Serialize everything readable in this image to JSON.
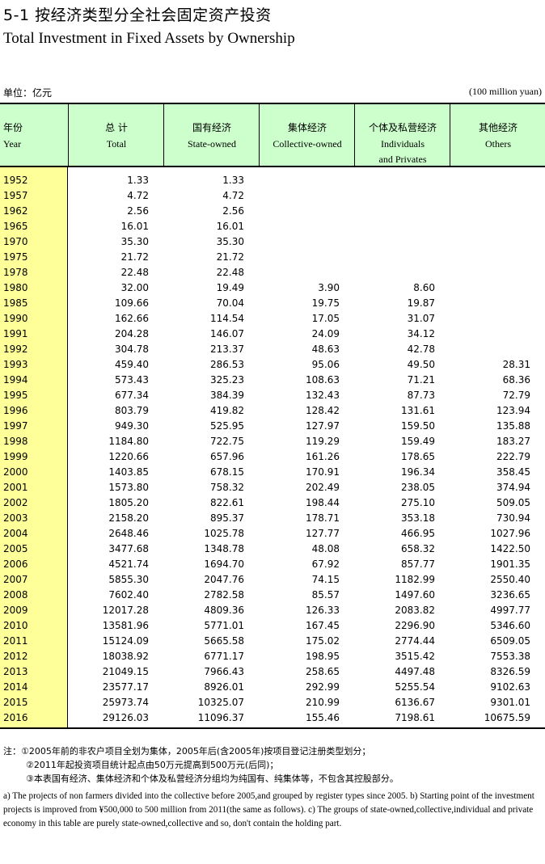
{
  "title": {
    "cn": "5-1 按经济类型分全社会固定资产投资",
    "en": "Total Investment in Fixed Assets by Ownership"
  },
  "unit": {
    "cn": "单位：亿元",
    "en": "(100 million yuan)"
  },
  "columns": {
    "year": {
      "cn": "年份",
      "en": "Year"
    },
    "total": {
      "cn": "总 计",
      "en": "Total"
    },
    "state": {
      "cn": "国有经济",
      "en": "State-owned"
    },
    "collective": {
      "cn": "集体经济",
      "en": "Collective-owned"
    },
    "individual": {
      "cn": "个体及私营经济",
      "en1": "Individuals",
      "en2": "and Privates"
    },
    "others": {
      "cn": "其他经济",
      "en": "Others"
    }
  },
  "rows": [
    [
      "1952",
      "1.33",
      "1.33",
      "",
      "",
      ""
    ],
    [
      "1957",
      "4.72",
      "4.72",
      "",
      "",
      ""
    ],
    [
      "1962",
      "2.56",
      "2.56",
      "",
      "",
      ""
    ],
    [
      "1965",
      "16.01",
      "16.01",
      "",
      "",
      ""
    ],
    [
      "1970",
      "35.30",
      "35.30",
      "",
      "",
      ""
    ],
    [
      "1975",
      "21.72",
      "21.72",
      "",
      "",
      ""
    ],
    [
      "1978",
      "22.48",
      "22.48",
      "",
      "",
      ""
    ],
    [
      "1980",
      "32.00",
      "19.49",
      "3.90",
      "8.60",
      ""
    ],
    [
      "1985",
      "109.66",
      "70.04",
      "19.75",
      "19.87",
      ""
    ],
    [
      "1990",
      "162.66",
      "114.54",
      "17.05",
      "31.07",
      ""
    ],
    [
      "1991",
      "204.28",
      "146.07",
      "24.09",
      "34.12",
      ""
    ],
    [
      "1992",
      "304.78",
      "213.37",
      "48.63",
      "42.78",
      ""
    ],
    [
      "1993",
      "459.40",
      "286.53",
      "95.06",
      "49.50",
      "28.31"
    ],
    [
      "1994",
      "573.43",
      "325.23",
      "108.63",
      "71.21",
      "68.36"
    ],
    [
      "1995",
      "677.34",
      "384.39",
      "132.43",
      "87.73",
      "72.79"
    ],
    [
      "1996",
      "803.79",
      "419.82",
      "128.42",
      "131.61",
      "123.94"
    ],
    [
      "1997",
      "949.30",
      "525.95",
      "127.97",
      "159.50",
      "135.88"
    ],
    [
      "1998",
      "1184.80",
      "722.75",
      "119.29",
      "159.49",
      "183.27"
    ],
    [
      "1999",
      "1220.66",
      "657.96",
      "161.26",
      "178.65",
      "222.79"
    ],
    [
      "2000",
      "1403.85",
      "678.15",
      "170.91",
      "196.34",
      "358.45"
    ],
    [
      "2001",
      "1573.80",
      "758.32",
      "202.49",
      "238.05",
      "374.94"
    ],
    [
      "2002",
      "1805.20",
      "822.61",
      "198.44",
      "275.10",
      "509.05"
    ],
    [
      "2003",
      "2158.20",
      "895.37",
      "178.71",
      "353.18",
      "730.94"
    ],
    [
      "2004",
      "2648.46",
      "1025.78",
      "127.77",
      "466.95",
      "1027.96"
    ],
    [
      "2005",
      "3477.68",
      "1348.78",
      "48.08",
      "658.32",
      "1422.50"
    ],
    [
      "2006",
      "4521.74",
      "1694.70",
      "67.92",
      "857.77",
      "1901.35"
    ],
    [
      "2007",
      "5855.30",
      "2047.76",
      "74.15",
      "1182.99",
      "2550.40"
    ],
    [
      "2008",
      "7602.40",
      "2782.58",
      "85.57",
      "1497.60",
      "3236.65"
    ],
    [
      "2009",
      "12017.28",
      "4809.36",
      "126.33",
      "2083.82",
      "4997.77"
    ],
    [
      "2010",
      "13581.96",
      "5771.01",
      "167.45",
      "2296.90",
      "5346.60"
    ],
    [
      "2011",
      "15124.09",
      "5665.58",
      "175.02",
      "2774.44",
      "6509.05"
    ],
    [
      "2012",
      "18038.92",
      "6771.17",
      "198.95",
      "3515.42",
      "7553.38"
    ],
    [
      "2013",
      "21049.15",
      "7966.43",
      "258.65",
      "4497.48",
      "8326.59"
    ],
    [
      "2014",
      "23577.17",
      "8926.01",
      "292.99",
      "5255.54",
      "9102.63"
    ],
    [
      "2015",
      "25973.74",
      "10325.07",
      "210.99",
      "6136.67",
      "9301.01"
    ],
    [
      "2016",
      "29126.03",
      "11096.37",
      "155.46",
      "7198.61",
      "10675.59"
    ]
  ],
  "notes": {
    "cn1": "注：①2005年前的非农户项目全划为集体，2005年后(含2005年)按项目登记注册类型划分；",
    "cn2": "②2011年起投资项目统计起点由50万元提高到500万元(后同)；",
    "cn3": "③本表国有经济、集体经济和个体及私营经济分组均为纯国有、纯集体等，不包含其控股部分。",
    "en": "a) The projects of non farmers divided into the collective before 2005,and grouped by register types since 2005. b) Starting point of the investment projects is improved from ¥500,000 to 500 million from 2011(the same as follows). c) The groups of state-owned,collective,individual and private economy in this table are purely state-owned,collective and so, don't contain the holding part."
  }
}
